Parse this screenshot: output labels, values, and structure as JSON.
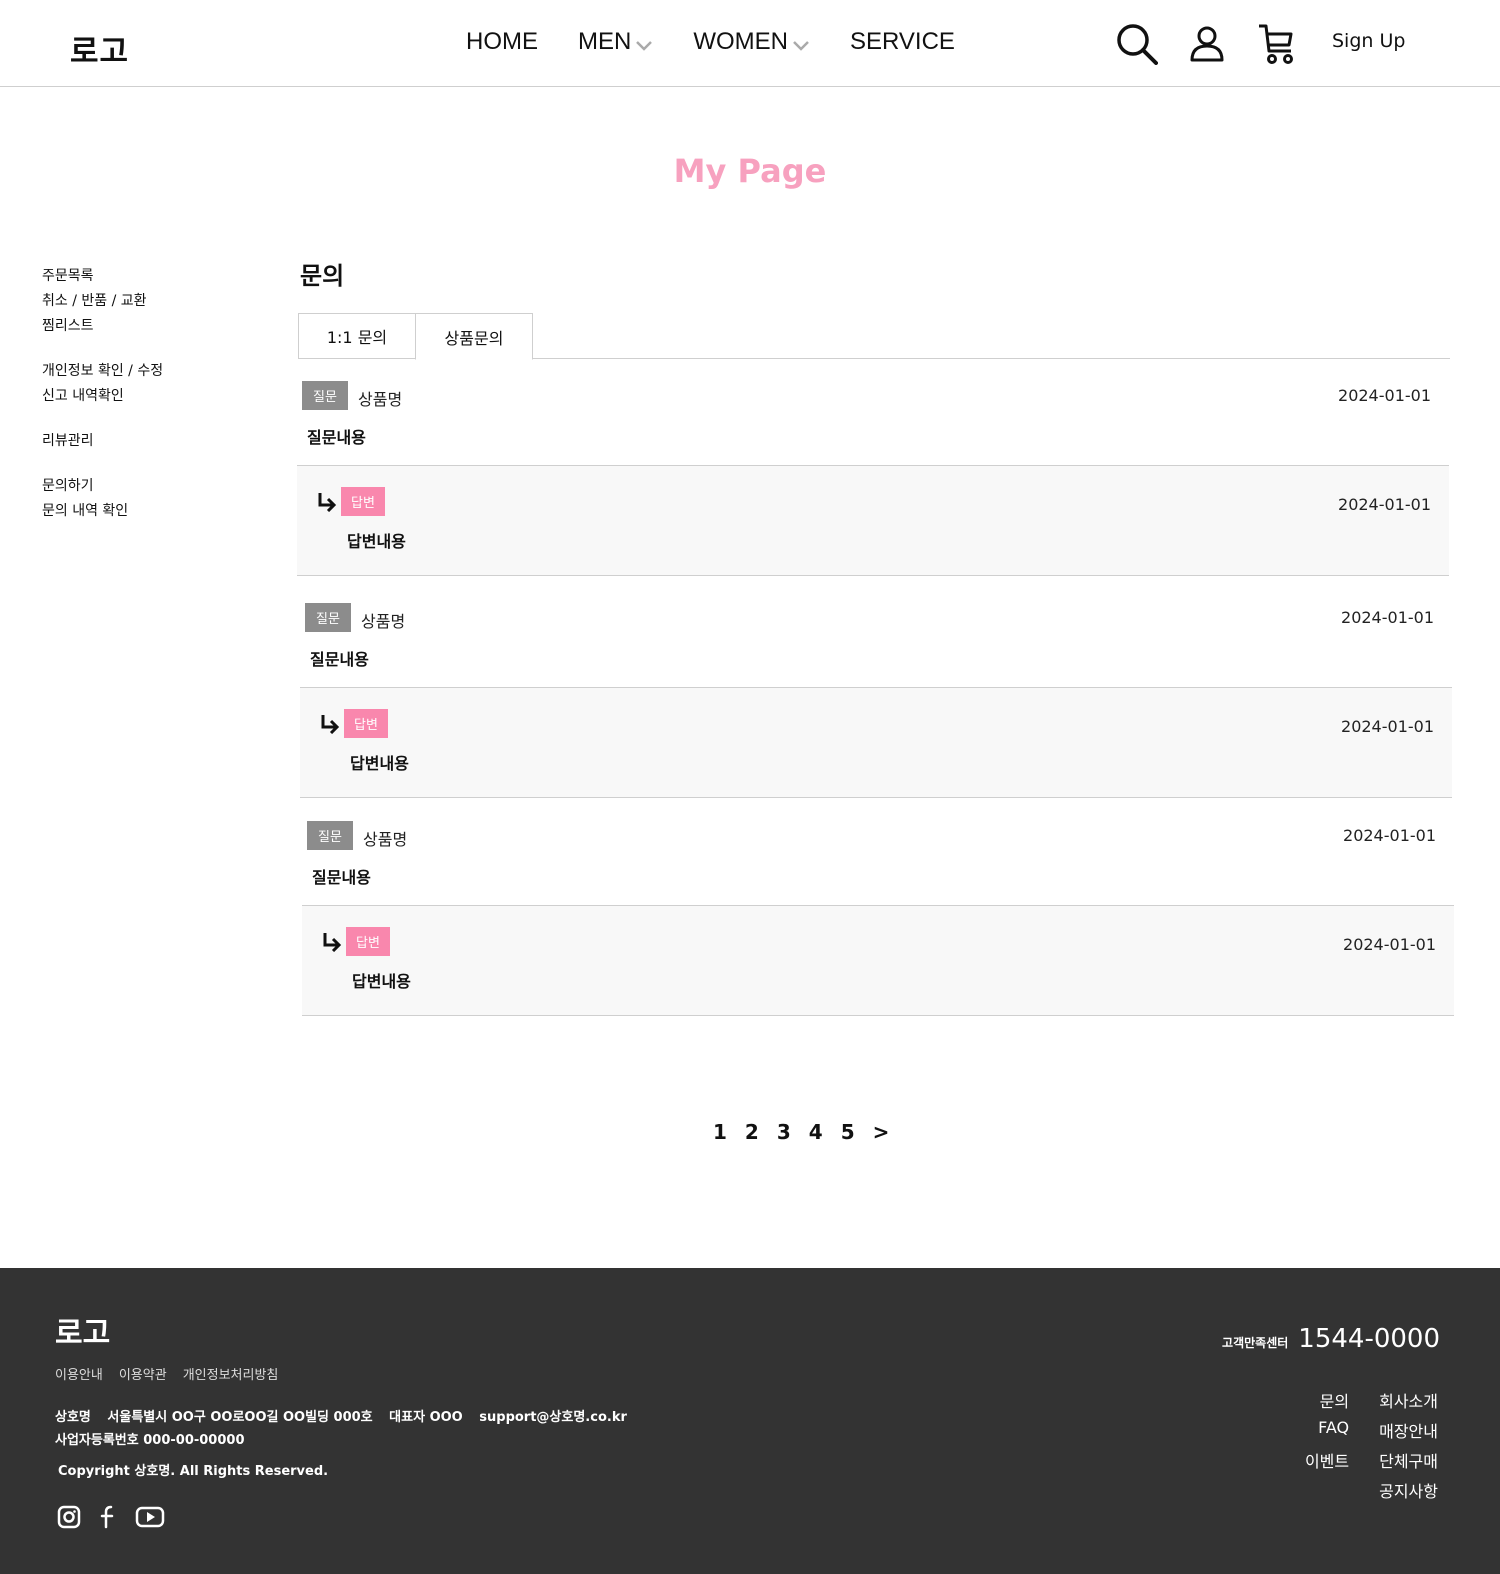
{
  "header": {
    "logo": "로고",
    "nav": [
      {
        "label": "HOME",
        "dropdown": false
      },
      {
        "label": "MEN",
        "dropdown": true
      },
      {
        "label": "WOMEN",
        "dropdown": true
      },
      {
        "label": "SERVICE",
        "dropdown": false
      }
    ],
    "icons": [
      "search-icon",
      "user-icon",
      "cart-icon"
    ],
    "signup": "Sign Up"
  },
  "page_title": "My Page",
  "sidebar": {
    "groups": [
      [
        "주문목록",
        "취소 / 반품 / 교환",
        "찜리스트"
      ],
      [
        "개인정보 확인 / 수정",
        "신고 내역확인"
      ],
      [
        "리뷰관리"
      ],
      [
        "문의하기",
        "문의 내역 확인"
      ]
    ]
  },
  "main": {
    "title": "문의",
    "tabs": [
      "1:1 문의",
      "상품문의"
    ],
    "active_tab": "상품문의",
    "entries": [
      {
        "q_badge": "질문",
        "product": "상품명",
        "question": "질문내용",
        "q_date": "2024-01-01",
        "a_badge": "답변",
        "answer": "답변내용",
        "a_date": "2024-01-01"
      },
      {
        "q_badge": "질문",
        "product": "상품명",
        "question": "질문내용",
        "q_date": "2024-01-01",
        "a_badge": "답변",
        "answer": "답변내용",
        "a_date": "2024-01-01"
      },
      {
        "q_badge": "질문",
        "product": "상품명",
        "question": "질문내용",
        "q_date": "2024-01-01",
        "a_badge": "답변",
        "answer": "답변내용",
        "a_date": "2024-01-01"
      }
    ]
  },
  "pagination": [
    "1",
    "2",
    "3",
    "4",
    "5",
    ">"
  ],
  "footer": {
    "logo": "로고",
    "links": [
      "이용안내",
      "이용약관",
      "개인정보처리방침"
    ],
    "company": "상호명",
    "address": "서울특별시 OO구 OO로OO길 OO빌딩 000호",
    "ceo": "대표자 OOO",
    "email": "support@상호명.co.kr",
    "business_no": "사업자등록번호 000-00-00000",
    "copyright": "Copyright 상호명. All Rights Reserved.",
    "social": [
      "instagram-icon",
      "facebook-icon",
      "youtube-icon"
    ],
    "cs_label": "고객만족센터",
    "cs_phone": "1544-0000",
    "menu": [
      "문의",
      "회사소개",
      "FAQ",
      "매장안내",
      "이벤트",
      "단체구매",
      "",
      "공지사항"
    ]
  },
  "colors": {
    "accent_pink": "#f7a1bf",
    "answer_badge": "#f987ad",
    "question_badge": "#8c8c8c",
    "footer_bg": "#333333"
  }
}
